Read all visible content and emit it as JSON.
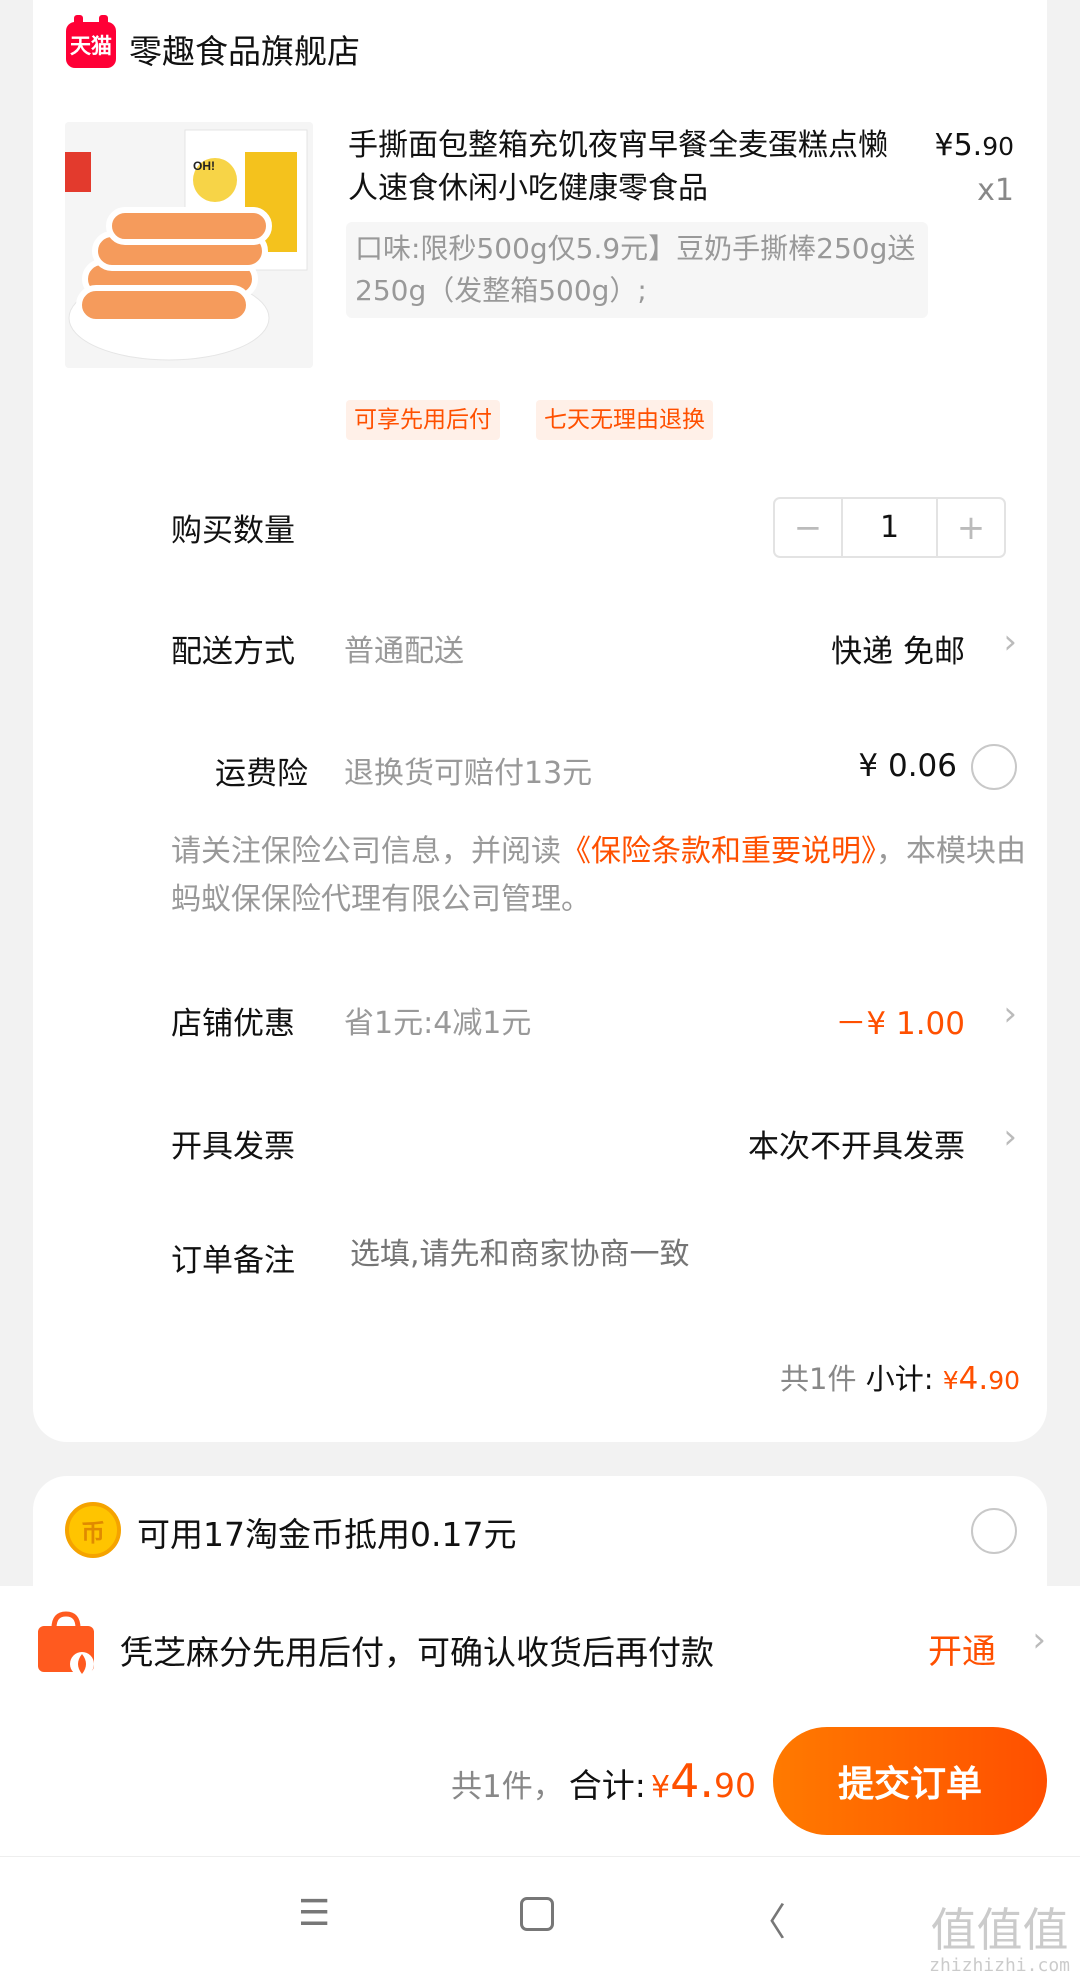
{
  "shop": {
    "badge": "天猫",
    "name": "零趣食品旗舰店"
  },
  "product": {
    "title": "手撕面包整箱充饥夜宵早餐全麦蛋糕点懒人速食休闲小吃健康零食品",
    "price_symbol": "¥",
    "price_int": "5.",
    "price_dec": "90",
    "qty": "x1",
    "sku": "口味:限秒500g仅5.9元】豆奶手撕棒250g送250g（发整箱500g）;",
    "image_text": "OH! DELICIOUS"
  },
  "tags": [
    "可享先用后付",
    "七天无理由退换"
  ],
  "quantity_row": {
    "label": "购买数量",
    "minus": "−",
    "value": "1",
    "plus": "+"
  },
  "delivery_row": {
    "label": "配送方式",
    "sub": "普通配送",
    "value": "快递 免邮"
  },
  "insurance_row": {
    "label": "运费险",
    "sub": "退换货可赔付13元",
    "value": "¥ 0.06"
  },
  "notice": {
    "before": "请关注保险公司信息，并阅读",
    "link": "《保险条款和重要说明》",
    "after": "，本模块由蚂蚁保保险代理有限公司管理。"
  },
  "discount_row": {
    "label": "店铺优惠",
    "sub": "省1元:4减1元",
    "value": "－¥ 1.00"
  },
  "invoice_row": {
    "label": "开具发票",
    "value": "本次不开具发票"
  },
  "remark_row": {
    "label": "订单备注",
    "placeholder": "选填,请先和商家协商一致"
  },
  "subtotal": {
    "count": "共1件",
    "label": "小计:",
    "symbol": "¥",
    "int": "4.",
    "dec": "90"
  },
  "coins": {
    "icon_glyph": "币",
    "text": "可用17淘金币抵用0.17元"
  },
  "pay_later": {
    "text": "凭芝麻分先用后付，可确认收货后再付款",
    "action": "开通"
  },
  "checkout": {
    "count": "共1件，",
    "label": "合计:",
    "symbol": "¥",
    "int": "4.",
    "dec": "90",
    "submit": "提交订单"
  },
  "nav": {
    "menu": "☰",
    "home": "▢",
    "back": "〈"
  },
  "watermark": {
    "glyph": "值值值",
    "url": "zhizhizhi.com"
  },
  "colors": {
    "accent": "#ff5000",
    "tmall": "#ff0036",
    "coin": "#ffc400"
  }
}
